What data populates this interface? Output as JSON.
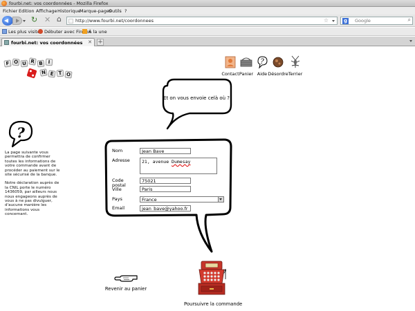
{
  "window": {
    "title": "fourbi.net: vos coordonnées - Mozilla Firefox"
  },
  "menu": [
    "Fichier",
    "Edition",
    "Affichage",
    "Historique",
    "Marque-pages",
    "Outils",
    "?"
  ],
  "navigation": {
    "url": "http://www.fourbi.net/coordonnees",
    "search_placeholder": "Google"
  },
  "bookmarks": [
    "Les plus visités",
    "Débuter avec Firefox",
    "À la une"
  ],
  "tab": {
    "label": "fourbi.net: vos coordonnées"
  },
  "logo": {
    "letters_top": [
      "F",
      "O",
      "U",
      "R",
      "B",
      "I"
    ],
    "letters_bottom": [
      "N",
      "E",
      "T",
      "O"
    ]
  },
  "topnav": [
    {
      "label": "Contact",
      "icon": "contact-icon"
    },
    {
      "label": "Panier",
      "icon": "basket-icon"
    },
    {
      "label": "Aide",
      "icon": "help-icon"
    },
    {
      "label": "Désordre",
      "icon": "disorder-icon"
    },
    {
      "label": "Terrier",
      "icon": "burrow-icon"
    }
  ],
  "bubble_question": "Et on vous envoie celà où ?",
  "sidebar": {
    "paragraph1": "La page suivante vous permettra de confirmer toutes les informations de votre commande avant de procéder au paiement sur le site sécurisé de la banque.",
    "paragraph2": "Notre déclaration auprès de la CNIL porte le numéro 1436059, par ailleurs nous nous engageons auprès de vous à ne pas divulguer, d'aucune manière les informations vous concernant."
  },
  "form": {
    "nom": {
      "label": "Nom",
      "value": "Jean Bave"
    },
    "adresse": {
      "label": "Adresse",
      "value_prefix": "21, avenue ",
      "value_word": "Dumesay"
    },
    "code_postal": {
      "label": "Code postal",
      "value": "75021"
    },
    "ville": {
      "label": "Ville",
      "value": "Paris"
    },
    "pays": {
      "label": "Pays",
      "value": "France"
    },
    "email": {
      "label": "Email",
      "value": "jean_bave@yahoo.fr"
    }
  },
  "actions": {
    "back": "Revenir au panier",
    "continue": "Poursuivre la commande"
  }
}
